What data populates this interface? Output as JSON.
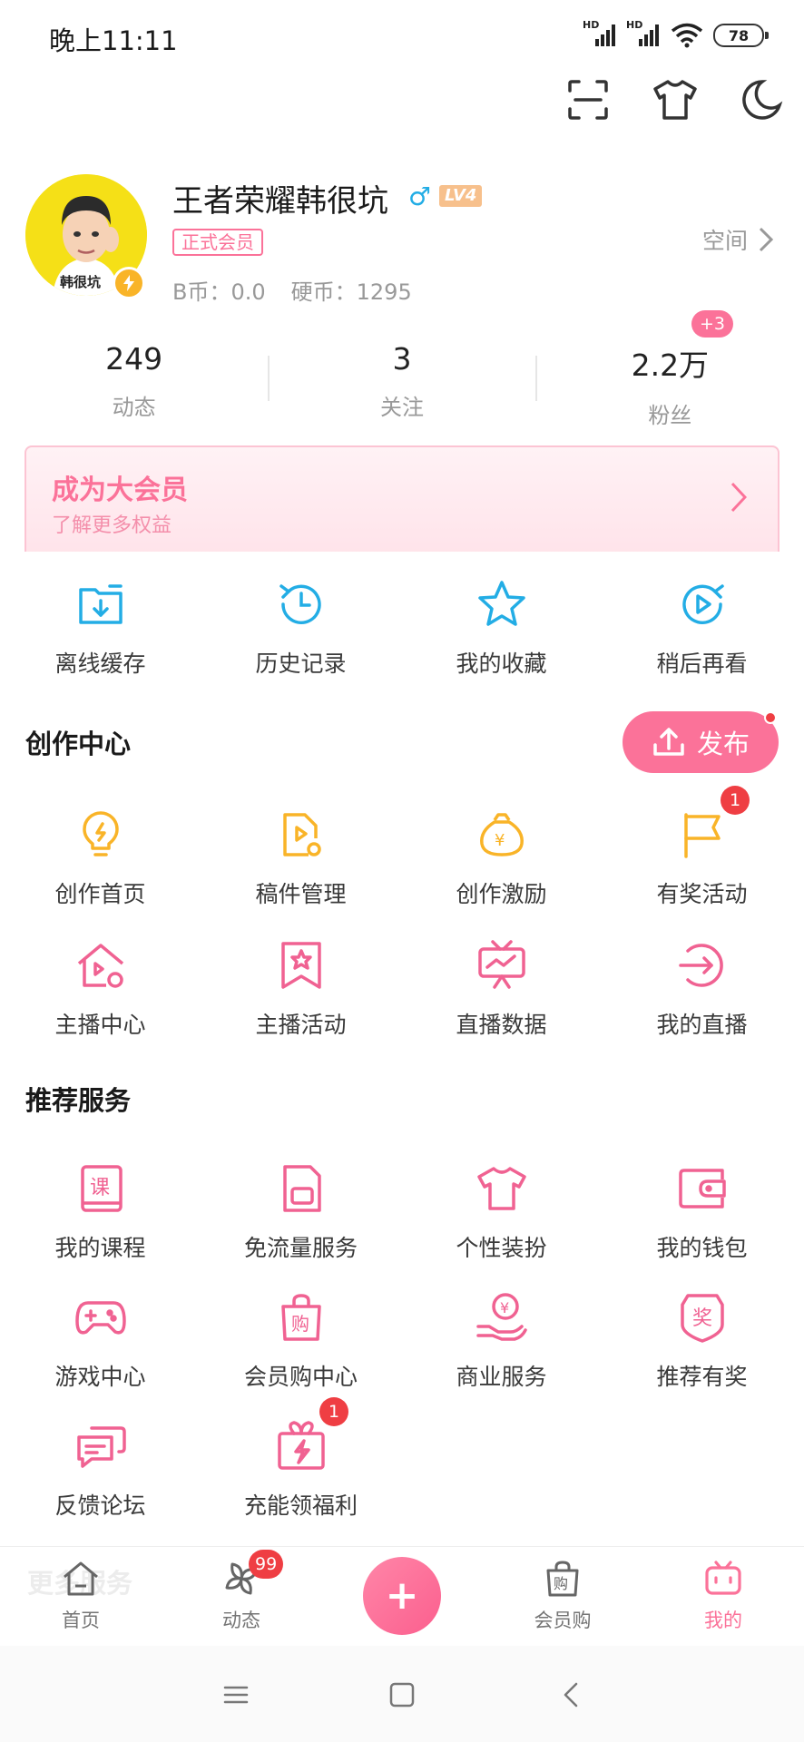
{
  "status_bar": {
    "time": "晚上11:11",
    "signal_label": "HD",
    "battery": "78"
  },
  "top_tools": [
    "scan-icon",
    "tshirt-icon",
    "moon-icon"
  ],
  "profile": {
    "username": "王者荣耀韩很坑",
    "gender_symbol": "♂",
    "level": "LV4",
    "vip_tag": "正式会员",
    "b_coin": "B币：0.0",
    "hard_coin": "硬币：1295",
    "space_link": "空间",
    "avatar_caption": "韩很坑"
  },
  "stats": [
    {
      "value": "249",
      "label": "动态"
    },
    {
      "value": "3",
      "label": "关注"
    },
    {
      "value": "2.2万",
      "label": "粉丝",
      "badge": "+3"
    }
  ],
  "vip_banner": {
    "title": "成为大会员",
    "subtitle": "了解更多权益"
  },
  "quick_actions": [
    {
      "label": "离线缓存",
      "icon": "download-folder-icon"
    },
    {
      "label": "历史记录",
      "icon": "history-clock-icon"
    },
    {
      "label": "我的收藏",
      "icon": "star-icon"
    },
    {
      "label": "稍后再看",
      "icon": "watch-later-icon"
    }
  ],
  "creation": {
    "title": "创作中心",
    "publish_label": "发布",
    "items": [
      {
        "label": "创作首页",
        "icon": "lightbulb-icon"
      },
      {
        "label": "稿件管理",
        "icon": "manuscript-icon"
      },
      {
        "label": "创作激励",
        "icon": "money-bag-icon"
      },
      {
        "label": "有奖活动",
        "icon": "flag-icon",
        "badge": "1"
      },
      {
        "label": "主播中心",
        "icon": "anchor-home-icon"
      },
      {
        "label": "主播活动",
        "icon": "bookmark-star-icon"
      },
      {
        "label": "直播数据",
        "icon": "live-data-icon"
      },
      {
        "label": "我的直播",
        "icon": "enter-live-icon"
      }
    ]
  },
  "services": {
    "title": "推荐服务",
    "items": [
      {
        "label": "我的课程",
        "icon": "course-book-icon",
        "glyph": "课"
      },
      {
        "label": "免流量服务",
        "icon": "sim-card-icon"
      },
      {
        "label": "个性装扮",
        "icon": "tshirt-icon"
      },
      {
        "label": "我的钱包",
        "icon": "wallet-icon"
      },
      {
        "label": "游戏中心",
        "icon": "gamepad-icon"
      },
      {
        "label": "会员购中心",
        "icon": "shopping-bag-icon",
        "glyph": "购"
      },
      {
        "label": "商业服务",
        "icon": "hand-coin-icon"
      },
      {
        "label": "推荐有奖",
        "icon": "reward-shield-icon",
        "glyph": "奖"
      },
      {
        "label": "反馈论坛",
        "icon": "chat-bubbles-icon"
      },
      {
        "label": "充能领福利",
        "icon": "gift-charge-icon",
        "badge": "1"
      }
    ]
  },
  "ghost_section_title": "更多服务",
  "bottom_nav": {
    "items": [
      {
        "label": "首页",
        "icon": "home-icon"
      },
      {
        "label": "动态",
        "icon": "pinwheel-icon",
        "badge": "99"
      },
      {
        "label": "会员购",
        "icon": "shopping-bag-icon",
        "glyph": "购"
      },
      {
        "label": "我的",
        "icon": "tv-face-icon",
        "active": true
      }
    ],
    "center_label": "+"
  },
  "colors": {
    "pink": "#fb7299",
    "blue": "#23ade5",
    "gold": "#f9b428",
    "red_badge": "#ef3e43"
  }
}
